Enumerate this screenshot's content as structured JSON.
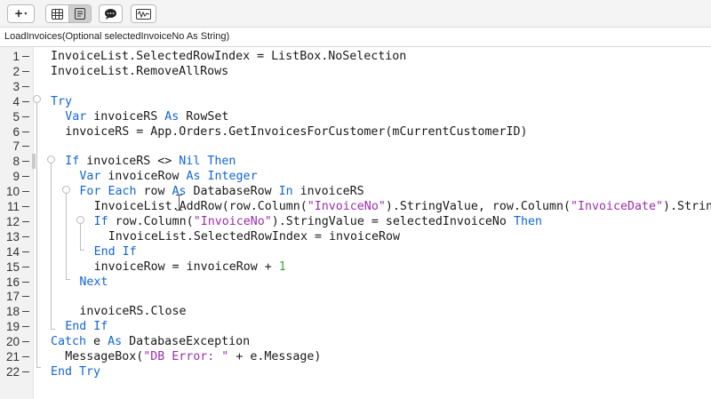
{
  "toolbar": {
    "add_label": "+",
    "add_caret": "▾",
    "buttons": [
      {
        "name": "grid-view-icon"
      },
      {
        "name": "code-view-icon"
      },
      {
        "name": "comment-icon"
      },
      {
        "name": "waveform-icon"
      }
    ]
  },
  "method_signature": "LoadInvoices(Optional selectedInvoiceNo As String)",
  "current_line": 8,
  "code_lines": [
    {
      "no": "1",
      "indent": 0,
      "tokens": [
        [
          "t",
          "InvoiceList.SelectedRowIndex = ListBox.NoSelection"
        ]
      ]
    },
    {
      "no": "2",
      "indent": 0,
      "tokens": [
        [
          "t",
          "InvoiceList.RemoveAllRows"
        ]
      ]
    },
    {
      "no": "3",
      "indent": 0,
      "tokens": []
    },
    {
      "no": "4",
      "indent": 0,
      "tokens": [
        [
          "k",
          "Try"
        ]
      ]
    },
    {
      "no": "5",
      "indent": 1,
      "tokens": [
        [
          "k",
          "Var"
        ],
        [
          "t",
          " invoiceRS "
        ],
        [
          "k",
          "As"
        ],
        [
          "t",
          " RowSet"
        ]
      ]
    },
    {
      "no": "6",
      "indent": 1,
      "tokens": [
        [
          "t",
          "invoiceRS = App.Orders.GetInvoicesForCustomer(mCurrentCustomerID)"
        ]
      ]
    },
    {
      "no": "7",
      "indent": 0,
      "tokens": []
    },
    {
      "no": "8",
      "indent": 1,
      "tokens": [
        [
          "k",
          "If"
        ],
        [
          "t",
          " invoiceRS <> "
        ],
        [
          "k",
          "Nil"
        ],
        [
          "t",
          " "
        ],
        [
          "k",
          "Then"
        ]
      ]
    },
    {
      "no": "9",
      "indent": 2,
      "tokens": [
        [
          "k",
          "Var"
        ],
        [
          "t",
          " invoiceRow "
        ],
        [
          "k",
          "As"
        ],
        [
          "t",
          " "
        ],
        [
          "k",
          "Integer"
        ]
      ]
    },
    {
      "no": "10",
      "indent": 2,
      "tokens": [
        [
          "k",
          "For"
        ],
        [
          "t",
          " "
        ],
        [
          "k",
          "Each"
        ],
        [
          "t",
          " row "
        ],
        [
          "k",
          "As"
        ],
        [
          "t",
          " DatabaseRow "
        ],
        [
          "k",
          "In"
        ],
        [
          "t",
          " invoiceRS"
        ]
      ]
    },
    {
      "no": "11",
      "indent": 3,
      "tokens": [
        [
          "t",
          "InvoiceList.AddRow(row.Column("
        ],
        [
          "s",
          "\"InvoiceNo\""
        ],
        [
          "t",
          ").StringValue, row.Column("
        ],
        [
          "s",
          "\"InvoiceDate\""
        ],
        [
          "t",
          ").StringValue"
        ]
      ]
    },
    {
      "no": "12",
      "indent": 3,
      "tokens": [
        [
          "k",
          "If"
        ],
        [
          "t",
          " row.Column("
        ],
        [
          "s",
          "\"InvoiceNo\""
        ],
        [
          "t",
          ").StringValue = selectedInvoiceNo "
        ],
        [
          "k",
          "Then"
        ]
      ]
    },
    {
      "no": "13",
      "indent": 4,
      "tokens": [
        [
          "t",
          "InvoiceList.SelectedRowIndex = invoiceRow"
        ]
      ]
    },
    {
      "no": "14",
      "indent": 3,
      "tokens": [
        [
          "k",
          "End If"
        ]
      ]
    },
    {
      "no": "15",
      "indent": 3,
      "tokens": [
        [
          "t",
          "invoiceRow = invoiceRow + "
        ],
        [
          "n",
          "1"
        ]
      ]
    },
    {
      "no": "16",
      "indent": 2,
      "tokens": [
        [
          "k",
          "Next"
        ]
      ]
    },
    {
      "no": "17",
      "indent": 0,
      "tokens": []
    },
    {
      "no": "18",
      "indent": 2,
      "tokens": [
        [
          "t",
          "invoiceRS.Close"
        ]
      ]
    },
    {
      "no": "19",
      "indent": 1,
      "tokens": [
        [
          "k",
          "End If"
        ]
      ]
    },
    {
      "no": "20",
      "indent": 0,
      "tokens": [
        [
          "k",
          "Catch"
        ],
        [
          "t",
          " e "
        ],
        [
          "k",
          "As"
        ],
        [
          "t",
          " DatabaseException"
        ]
      ]
    },
    {
      "no": "21",
      "indent": 1,
      "tokens": [
        [
          "t",
          "MessageBox("
        ],
        [
          "s",
          "\"DB Error: \""
        ],
        [
          "t",
          " + e.Message)"
        ]
      ]
    },
    {
      "no": "22",
      "indent": 0,
      "tokens": [
        [
          "k",
          "End Try"
        ]
      ]
    }
  ],
  "colors": {
    "keyword": "#1366d6",
    "string": "#9b2fae",
    "number": "#3ca53c",
    "text": "#1a1a1a"
  }
}
